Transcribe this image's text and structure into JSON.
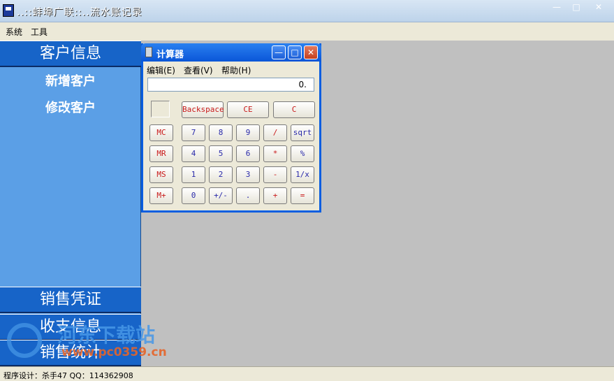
{
  "window": {
    "title": "..::蚌埠广联::..流水账记录",
    "minimize": "—",
    "maximize": "□",
    "close": "✕"
  },
  "menu": [
    "系统",
    "工具"
  ],
  "sidebar": {
    "customer_header": "客户信息",
    "customer_items": [
      "新增客户",
      "修改客户"
    ],
    "sales_header": "销售凭证",
    "income_header": "收支信息",
    "stats_header": "销售统计"
  },
  "watermark": {
    "text": "河东下载站",
    "url": "www.pc0359.cn"
  },
  "calculator": {
    "title": "计算器",
    "menu": [
      "编辑(E)",
      "查看(V)",
      "帮助(H)"
    ],
    "display": "0.",
    "top_keys": [
      "Backspace",
      "CE",
      "C"
    ],
    "mem_keys": [
      "MC",
      "MR",
      "MS",
      "M+"
    ],
    "rows": [
      [
        "7",
        "8",
        "9",
        "/",
        "sqrt"
      ],
      [
        "4",
        "5",
        "6",
        "*",
        "%"
      ],
      [
        "1",
        "2",
        "3",
        "-",
        "1/x"
      ],
      [
        "0",
        "+/-",
        ".",
        "+",
        "="
      ]
    ]
  },
  "status": "程序设计：杀手47 QQ：114362908",
  "colors": {
    "sidebar": "#5b9fe6",
    "section_header": "#1764c8",
    "workspace": "#c0c0c0",
    "calc_title": "#0a56d8"
  }
}
